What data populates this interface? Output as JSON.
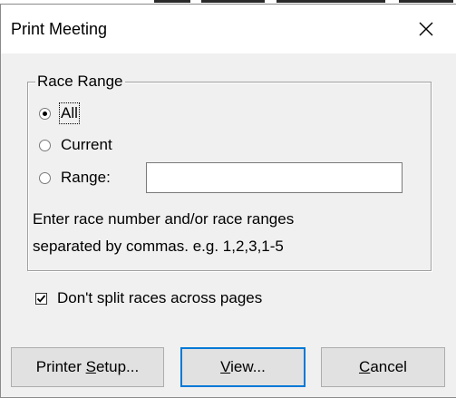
{
  "dialog": {
    "title": "Print Meeting"
  },
  "race_range": {
    "legend": "Race Range",
    "options": [
      {
        "label": "All",
        "checked": true
      },
      {
        "label": "Current",
        "checked": false
      },
      {
        "label": "Range:",
        "checked": false
      }
    ],
    "range_value": "",
    "help_line_1": "Enter race number and/or race ranges",
    "help_line_2": "separated by commas. e.g.  1,2,3,1-5"
  },
  "split_option": {
    "label": "Don't split races across pages",
    "checked": true
  },
  "buttons": {
    "printer_setup": {
      "before": "Printer ",
      "mnemonic": "S",
      "after": "etup..."
    },
    "view": {
      "before": "",
      "mnemonic": "V",
      "after": "iew..."
    },
    "cancel": {
      "before": "",
      "mnemonic": "C",
      "after": "ancel"
    }
  },
  "colors": {
    "dialog_bg": "#f0f0f0",
    "title_bg": "#ffffff",
    "button_bg": "#e1e1e1",
    "default_button_border": "#0078d7"
  },
  "icons": {
    "close": "close-icon",
    "check": "checkmark-icon"
  }
}
